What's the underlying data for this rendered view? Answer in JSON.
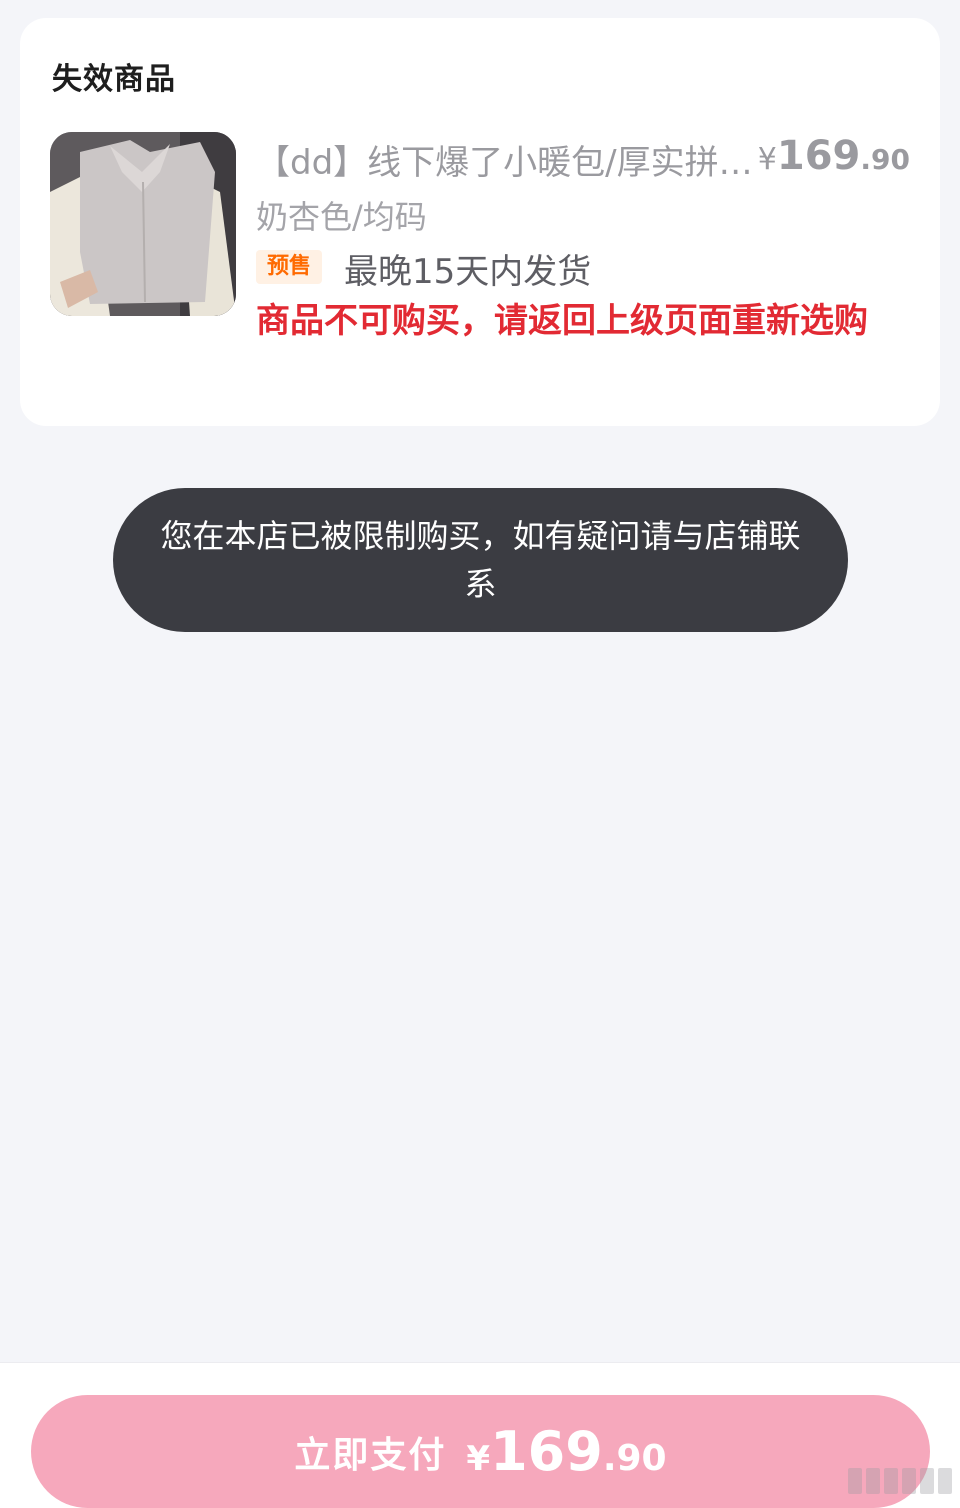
{
  "card": {
    "section_title": "失效商品",
    "product": {
      "image": "fur-jacket-photo",
      "title": "【dd】线下爆了小暖包/厚实拼接毛毛外套",
      "price_currency": "¥",
      "price_int": "169",
      "price_dec": ".90",
      "sku": "奶杏色/均码",
      "presale_badge": "预售",
      "shipping": "最晚15天内发货",
      "warning": "商品不可购买，请返回上级页面重新选购"
    }
  },
  "toast": {
    "message": "您在本店已被限制购买，如有疑问请与店铺联系"
  },
  "bottom": {
    "pay_label": "立即支付",
    "price_currency": "¥",
    "price_int": "169",
    "price_dec": ".90"
  },
  "colors": {
    "background": "#f4f5f9",
    "warning": "#e22a33",
    "presale": "#ff6a00",
    "pay_button": "#f6a8bc",
    "toast": "#3b3c42"
  }
}
